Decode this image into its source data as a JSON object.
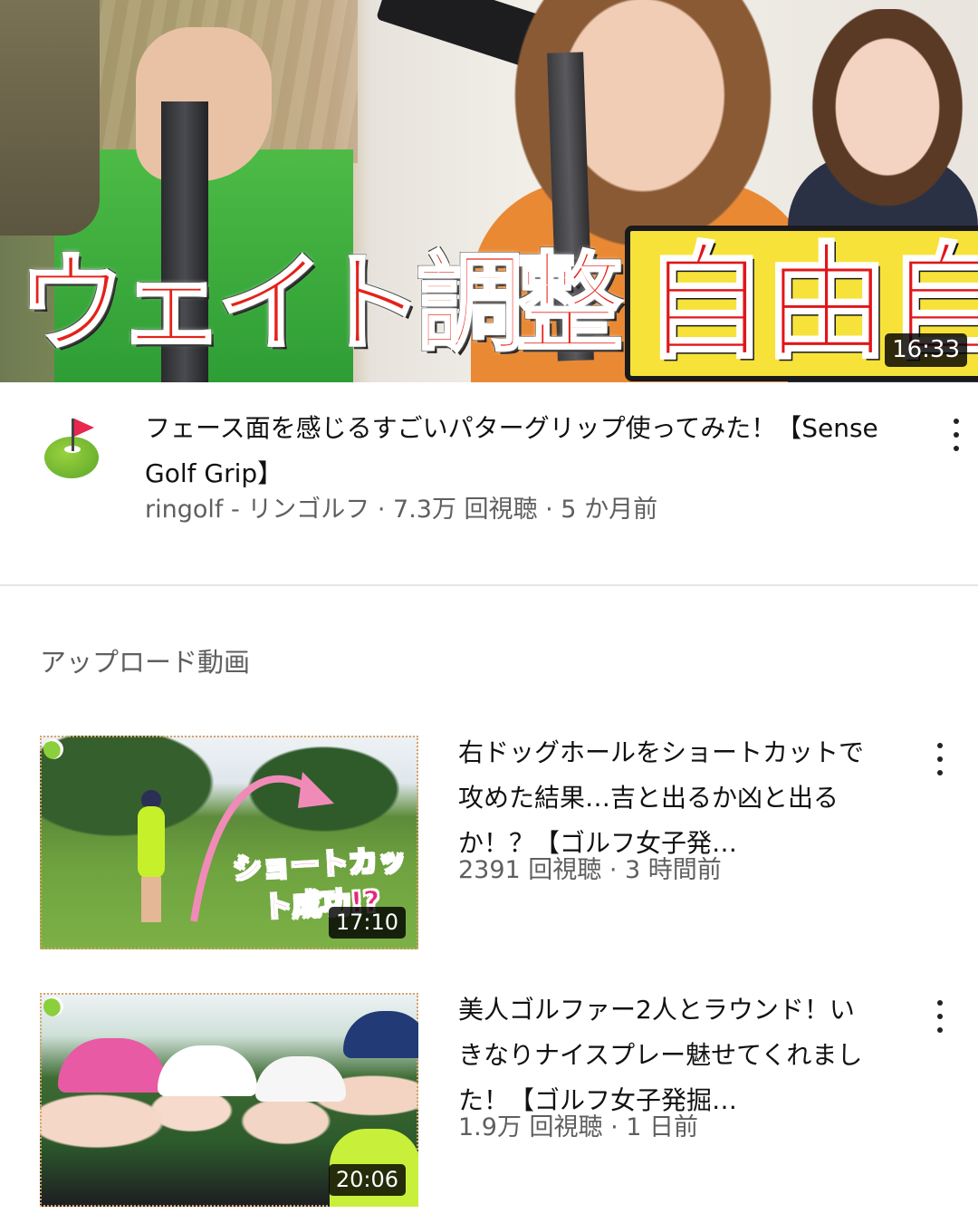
{
  "featured": {
    "thumbnail_caption_left": "ウェイト調整",
    "thumbnail_caption_right": "自由自在",
    "duration": "16:33",
    "title": "フェース面を感じるすごいパターグリップ使ってみた！【Sense Golf Grip】",
    "channel": "ringolf - リンゴルフ",
    "views": "7.3万 回視聴",
    "age": "5 か月前",
    "meta_line": "ringolf - リンゴルフ · 7.3万 回視聴 · 5 か月前"
  },
  "uploads": {
    "section_title": "アップロード動画",
    "videos": [
      {
        "title": "右ドッグホールをショートカットで攻めた結果…吉と出るか凶と出るか！？【ゴルフ女子発…",
        "thumbnail_caption": "ショートカット成功!?",
        "duration": "17:10",
        "meta_line": "2391 回視聴 · 3 時間前"
      },
      {
        "title": "美人ゴルファー2人とラウンド！いきなりナイスプレー魅せてくれました！【ゴルフ女子発掘…",
        "thumbnail_caption": "",
        "duration": "20:06",
        "meta_line": "1.9万 回視聴 · 1 日前"
      }
    ]
  },
  "colors": {
    "caption_red": "#e4221a",
    "caption_yellow": "#f7e23a",
    "meta_gray": "#5f5f5f",
    "thumb_caption_pink": "#e8267a"
  },
  "icons": [
    "more-vert-icon",
    "channel-avatar-apple-flag"
  ]
}
